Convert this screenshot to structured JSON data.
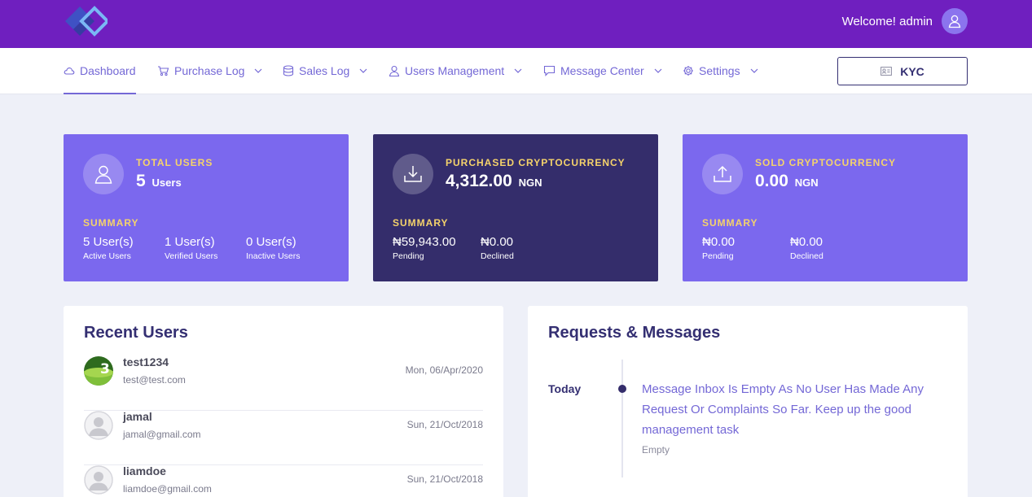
{
  "header": {
    "logo": "diamond-logo",
    "welcome_text": "Welcome! admin",
    "brand_color": "#6f1fbf"
  },
  "nav": {
    "items": [
      {
        "label": "Dashboard",
        "icon": "cloud-icon",
        "dropdown": false,
        "active": true
      },
      {
        "label": "Purchase Log",
        "icon": "cart-icon",
        "dropdown": true
      },
      {
        "label": "Sales Log",
        "icon": "database-icon",
        "dropdown": true
      },
      {
        "label": "Users Management",
        "icon": "user-icon",
        "dropdown": true
      },
      {
        "label": "Message Center",
        "icon": "chat-icon",
        "dropdown": true
      },
      {
        "label": "Settings",
        "icon": "gear-icon",
        "dropdown": true
      }
    ],
    "kyc_label": "KYC",
    "accent_color": "#7468d6"
  },
  "cards": {
    "total_users": {
      "label": "TOTAL USERS",
      "value": "5",
      "unit": "Users",
      "summary_label": "SUMMARY",
      "stats": [
        {
          "amount": "5 User(s)",
          "caption": "Active Users"
        },
        {
          "amount": "1 User(s)",
          "caption": "Verified Users"
        },
        {
          "amount": "0 User(s)",
          "caption": "Inactive Users"
        }
      ]
    },
    "purchased": {
      "label": "PURCHASED CRYPTOCURRENCY",
      "value": "4,312.00",
      "unit": "NGN",
      "summary_label": "SUMMARY",
      "stats": [
        {
          "amount": "₦59,943.00",
          "caption": "Pending"
        },
        {
          "amount": "₦0.00",
          "caption": "Declined"
        }
      ]
    },
    "sold": {
      "label": "SOLD CRYPTOCURRENCY",
      "value": "0.00",
      "unit": "NGN",
      "summary_label": "SUMMARY",
      "stats": [
        {
          "amount": "₦0.00",
          "caption": "Pending"
        },
        {
          "amount": "₦0.00",
          "caption": "Declined"
        }
      ]
    }
  },
  "recent_users": {
    "title": "Recent Users",
    "users": [
      {
        "name": "test1234",
        "email": "test@test.com",
        "date": "Mon, 06/Apr/2020"
      },
      {
        "name": "jamal",
        "email": "jamal@gmail.com",
        "date": "Sun, 21/Oct/2018"
      },
      {
        "name": "liamdoe",
        "email": "liamdoe@gmail.com",
        "date": "Sun, 21/Oct/2018"
      }
    ]
  },
  "requests": {
    "title": "Requests & Messages",
    "today_label": "Today",
    "message": "Message Inbox Is Empty As No User Has Made Any Request Or Complaints So Far. Keep up the good management task",
    "status": "Empty"
  }
}
